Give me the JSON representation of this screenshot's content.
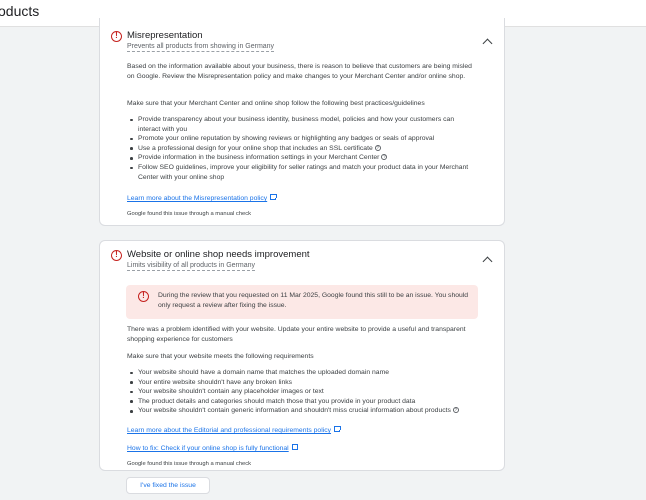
{
  "page": {
    "title": "oducts"
  },
  "issues": [
    {
      "title": "Misrepresentation",
      "subtitle": "Prevents all products from showing in Germany",
      "intro": "Based on the information available about your business, there is reason to believe that customers are being misled on Google. Review the Misrepresentation policy and make changes to your Merchant Center and/or online shop.",
      "lead": "Make sure that your Merchant Center and online shop follow the following best practices/guidelines",
      "bullets": [
        "Provide transparency about your business identity, business model, policies and how your customers can interact with you",
        "Promote your online reputation by showing reviews or highlighting any badges or seals of approval",
        "Use a professional design for your online shop that includes an SSL certificate",
        "Provide information in the business information settings in your Merchant Center",
        "Follow SEO guidelines, improve your eligibility for seller ratings and match your product data in your Merchant Center with your online shop"
      ],
      "link": "Learn more about the Misrepresentation policy",
      "found_by": "Google found this issue through a manual check"
    },
    {
      "title": "Website or online shop needs improvement",
      "subtitle": "Limits visibility of all products in Germany",
      "banner": "During the review that you requested on 11 Mar 2025, Google found this still to be an issue. You should only request a review after fixing the issue.",
      "intro": "There was a problem identified with your website. Update your entire website to provide a useful and transparent shopping experience for customers",
      "lead": "Make sure that your website meets the following requirements",
      "bullets": [
        "Your website should have a domain name that matches the uploaded domain name",
        "Your entire website shouldn't have any broken links",
        "Your website shouldn't contain any placeholder images or text",
        "The product details and categories should match those that you provide in your product data",
        "Your website shouldn't contain generic information and shouldn't miss crucial information about products"
      ],
      "link1": "Learn more about the Editorial and professional requirements policy",
      "link2": "How to fix: Check if your online shop is fully functional",
      "found_by": "Google found this issue through a manual check",
      "button": "I've fixed the issue"
    }
  ],
  "colors": {
    "error": "#c5221f",
    "link": "#1a73e8",
    "banner_bg": "#fce8e6"
  }
}
